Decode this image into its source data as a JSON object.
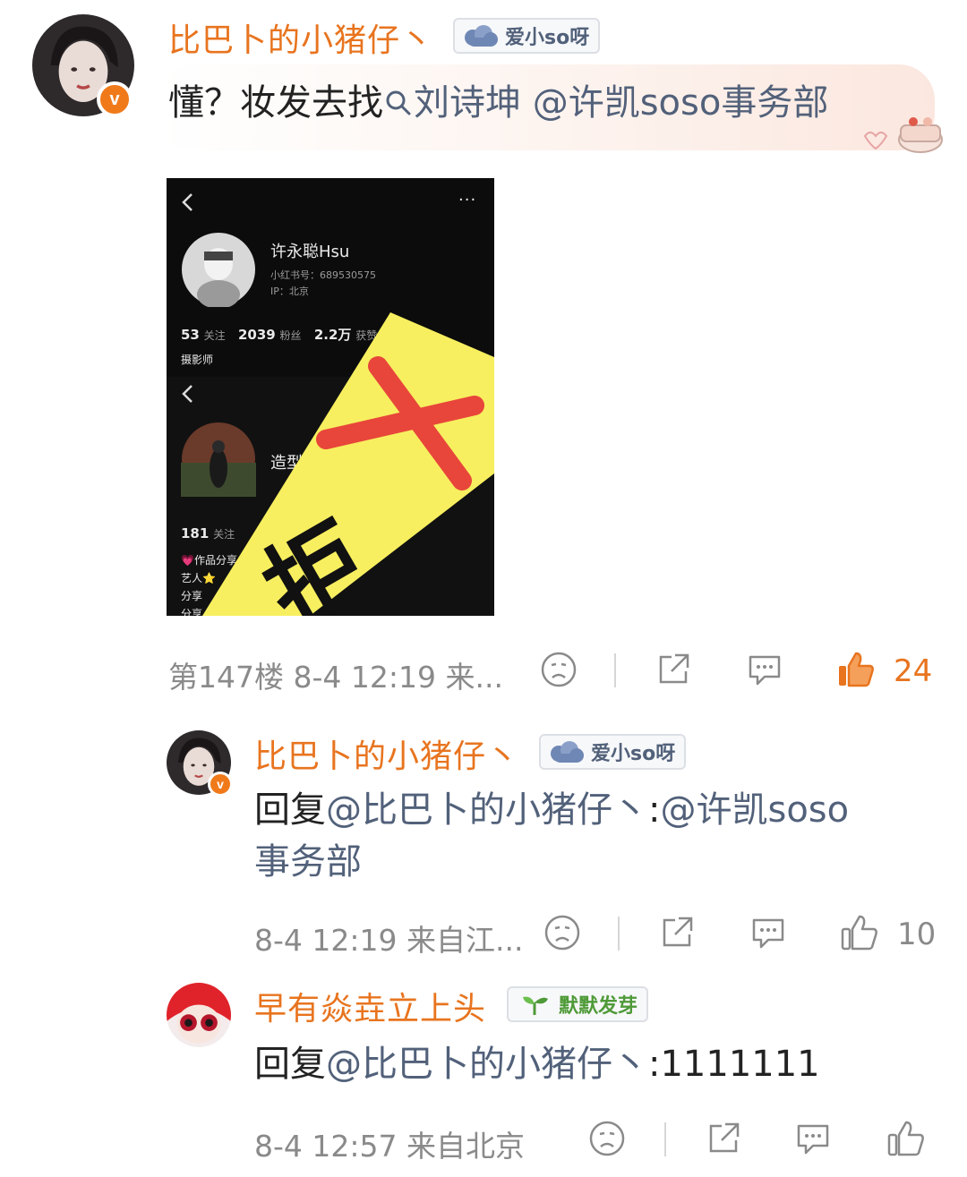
{
  "colors": {
    "orange": "#e8741f",
    "link": "#52617a",
    "gray": "#8a8a8a",
    "text": "#222222"
  },
  "comments": [
    {
      "username": "比巴卜的小猪仔丶",
      "badge": {
        "label": "爱小so呀",
        "icon": "cloud-icon"
      },
      "text_plain": "懂？妆发去找",
      "search_link": "刘诗坤",
      "mention": "@许凯soso事务部",
      "floor": "第147楼",
      "time": "8-4 12:19",
      "location": "来...",
      "likes": "24",
      "liked": true,
      "image": {
        "profile1": {
          "name": "许永聪Hsu",
          "id": "小红书号：689530575",
          "ip": "IP：北京",
          "follow_num": "53",
          "follow_label": "关注",
          "fans_num": "2039",
          "fans_label": "粉丝",
          "likes_num": "2.2万",
          "likes_label": "获赞",
          "bio": "摄影师"
        },
        "profile2": {
          "name": "造型",
          "follow_num": "181",
          "follow_label": "关注",
          "lines": [
            "💗作品分享",
            "艺人⭐",
            "分享",
            "分享"
          ]
        },
        "stamp_text": "拒"
      }
    },
    {
      "username": "比巴卜的小猪仔丶",
      "badge": {
        "label": "爱小so呀",
        "icon": "cloud-icon"
      },
      "reply_prefix": "回复",
      "reply_to": "@比巴卜的小猪仔丶",
      "reply_colon": ":",
      "reply_body_line1": "@许凯soso",
      "reply_body_line2": "事务部",
      "time": "8-4 12:19",
      "location": "来自江...",
      "likes": "10"
    },
    {
      "username": "早有焱垚立上头",
      "badge": {
        "label": "默默发芽",
        "icon": "sprout-icon"
      },
      "reply_prefix": "回复",
      "reply_to": "@比巴卜的小猪仔丶",
      "reply_colon": ":",
      "reply_body": "1111111",
      "time": "8-4 12:57",
      "location": "来自北京"
    }
  ]
}
